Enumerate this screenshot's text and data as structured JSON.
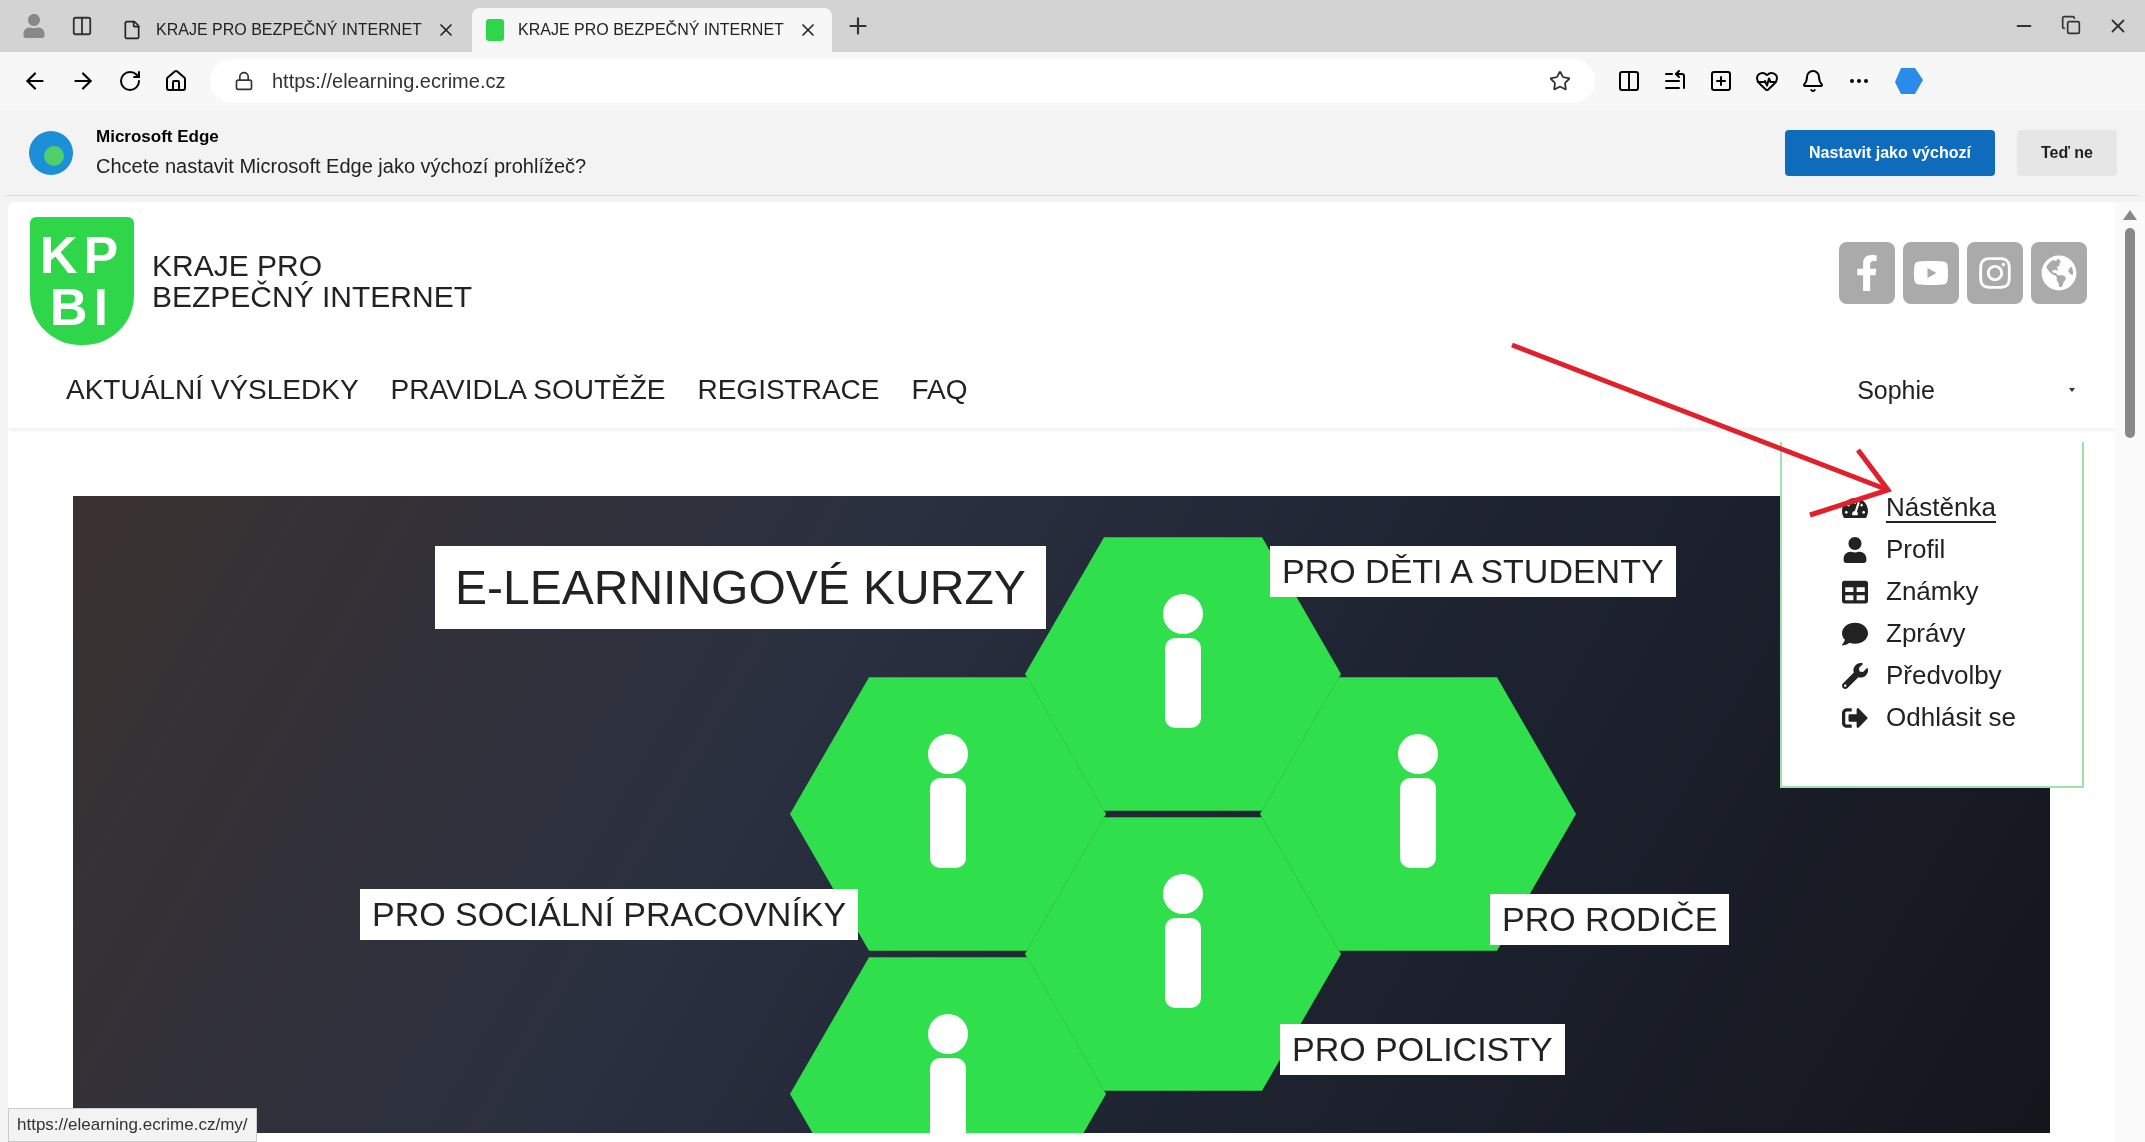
{
  "browser": {
    "tabs": [
      {
        "title": "KRAJE PRO BEZPEČNÝ INTERNET",
        "kind": "page",
        "selected": false
      },
      {
        "title": "KRAJE PRO BEZPEČNÝ INTERNET",
        "kind": "site",
        "selected": true
      }
    ],
    "address": "https://elearning.ecrime.cz",
    "infobar": {
      "title": "Microsoft Edge",
      "message": "Chcete nastavit Microsoft Edge jako výchozí prohlížeč?",
      "primary_button": "Nastavit jako výchozí",
      "secondary_button": "Teď ne"
    },
    "status_url": "https://elearning.ecrime.cz/my/"
  },
  "site": {
    "logo": {
      "mark_rows": [
        "KP",
        "BI"
      ],
      "line1": "KRAJE PRO",
      "line2": "BEZPEČNÝ INTERNET"
    },
    "social": [
      {
        "kind": "facebook"
      },
      {
        "kind": "youtube"
      },
      {
        "kind": "instagram"
      },
      {
        "kind": "globe"
      }
    ],
    "nav": [
      "AKTUÁLNÍ VÝSLEDKY",
      "PRAVIDLA SOUTĚŽE",
      "REGISTRACE",
      "FAQ"
    ],
    "user": "Sophie",
    "user_menu": [
      {
        "label": "Nástěnka",
        "kind": "dashboard",
        "selected": true
      },
      {
        "label": "Profil",
        "kind": "user",
        "selected": false
      },
      {
        "label": "Známky",
        "kind": "grid",
        "selected": false
      },
      {
        "label": "Zprávy",
        "kind": "chat",
        "selected": false
      },
      {
        "label": "Předvolby",
        "kind": "wrench",
        "selected": false
      },
      {
        "label": "Odhlásit se",
        "kind": "logout",
        "selected": false
      }
    ],
    "banner": {
      "title": "E-LEARNINGOVÉ KURZY",
      "labels": [
        "PRO DĚTI A STUDENTY",
        "PRO SOCIÁLNÍ PRACOVNÍKY",
        "PRO RODIČE",
        "PRO POLICISTY"
      ]
    }
  }
}
